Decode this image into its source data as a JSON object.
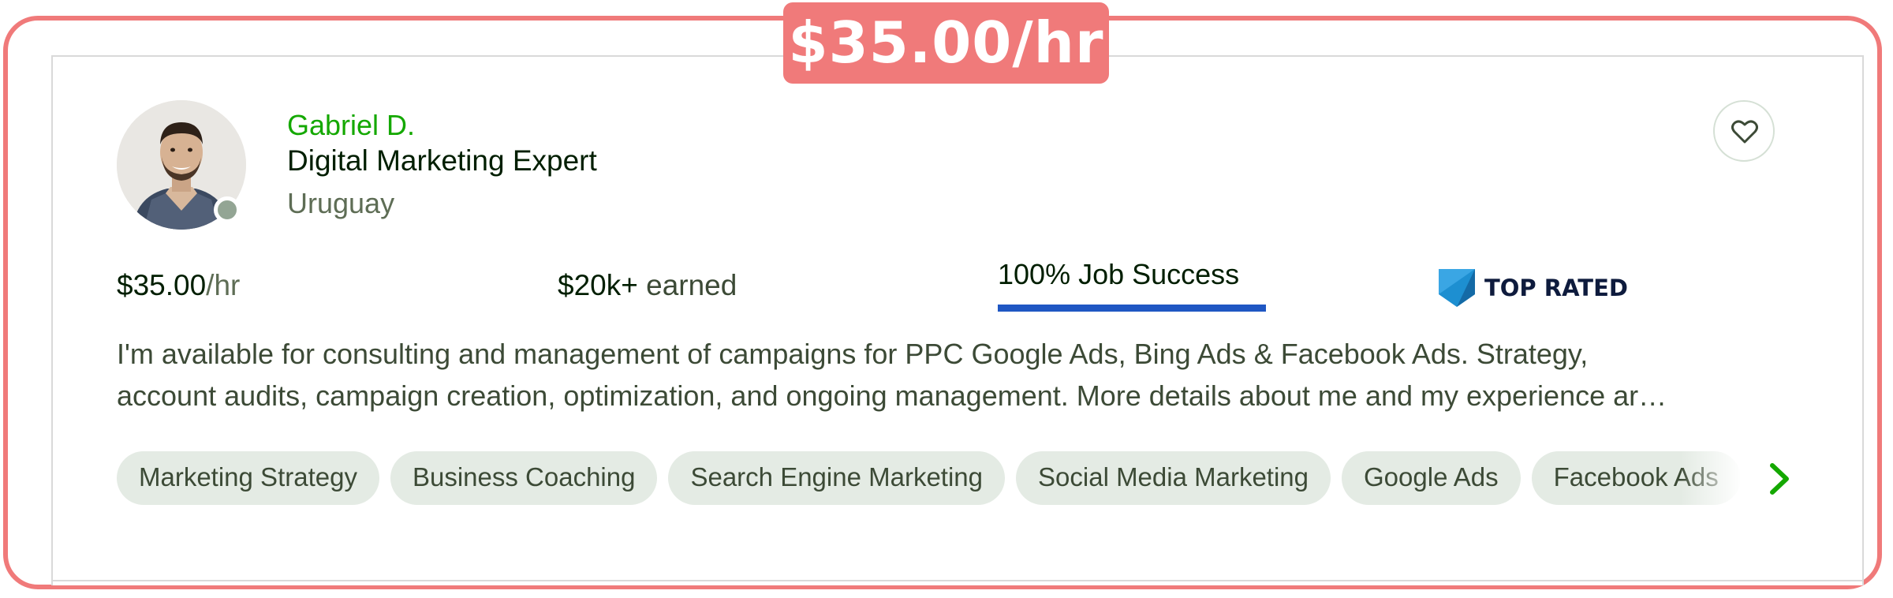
{
  "price_tag": "$35.00/hr",
  "profile": {
    "name": "Gabriel D.",
    "title": "Digital Marketing Expert",
    "country": "Uruguay",
    "online_status": "online"
  },
  "stats": {
    "rate_amount": "$35.00",
    "rate_unit": "/hr",
    "earned_amount": "$20k+",
    "earned_label": "earned",
    "job_success_label": "100% Job Success",
    "job_success_fraction": 1.0,
    "badge_label": "TOP RATED"
  },
  "description": {
    "line1": "I'm available for consulting and management of campaigns for PPC Google Ads, Bing Ads & Facebook Ads. Strategy,",
    "line2": "account audits, campaign creation, optimization, and ongoing management. More details about me and my experience ar…"
  },
  "skills": [
    "Marketing Strategy",
    "Business Coaching",
    "Search Engine Marketing",
    "Social Media Marketing",
    "Google Ads",
    "Facebook Ads"
  ],
  "icons": {
    "favorite": "heart-icon",
    "badge": "top-rated-badge-icon",
    "more_skills": "chevron-right-icon"
  },
  "colors": {
    "frame": "#f07a7a",
    "name": "#14a800",
    "chip_bg": "#e4ebe4",
    "success_bar": "#1f57c3",
    "badge_blue": "#1d8fd1"
  }
}
